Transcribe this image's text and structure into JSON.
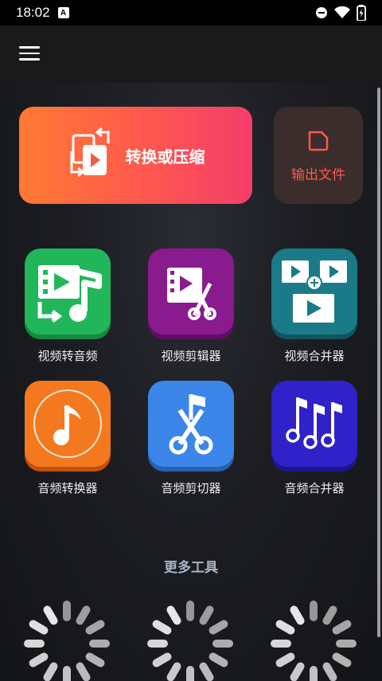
{
  "status_bar": {
    "time": "18:02",
    "badge": "A"
  },
  "header": {
    "menu_icon": "hamburger-icon"
  },
  "hero": {
    "convert_label": "转换或压缩",
    "output_label": "输出文件"
  },
  "tools": [
    {
      "label": "视频转音频",
      "icon": "video-to-audio-icon",
      "color": "#22b65a"
    },
    {
      "label": "视频剪辑器",
      "icon": "video-cutter-icon",
      "color": "#8a1b8f"
    },
    {
      "label": "视频合并器",
      "icon": "video-merger-icon",
      "color": "#1a7a88"
    },
    {
      "label": "音频转换器",
      "icon": "audio-converter-icon",
      "color": "#f4791e"
    },
    {
      "label": "音频剪切器",
      "icon": "audio-cutter-icon",
      "color": "#3b86e8"
    },
    {
      "label": "音频合并器",
      "icon": "audio-merger-icon",
      "color": "#2f22c9"
    }
  ],
  "more": {
    "title": "更多工具"
  },
  "colors": {
    "accent": "#ff5a4f",
    "background": "#1c1d22"
  }
}
